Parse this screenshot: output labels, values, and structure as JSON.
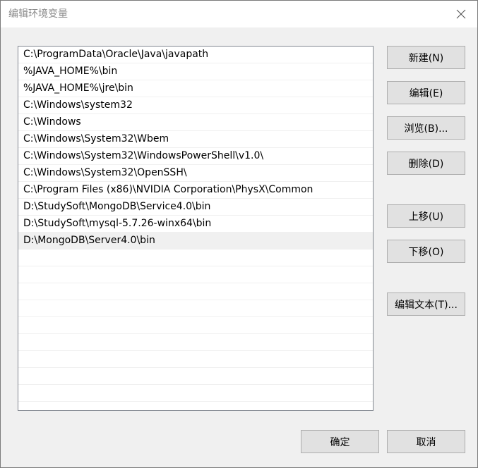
{
  "window": {
    "title": "编辑环境变量"
  },
  "path_list": {
    "items": [
      "C:\\ProgramData\\Oracle\\Java\\javapath",
      "%JAVA_HOME%\\bin",
      "%JAVA_HOME%\\jre\\bin",
      "C:\\Windows\\system32",
      "C:\\Windows",
      "C:\\Windows\\System32\\Wbem",
      "C:\\Windows\\System32\\WindowsPowerShell\\v1.0\\",
      "C:\\Windows\\System32\\OpenSSH\\",
      "C:\\Program Files (x86)\\NVIDIA Corporation\\PhysX\\Common",
      "D:\\StudySoft\\MongoDB\\Service4.0\\bin",
      "D:\\StudySoft\\mysql-5.7.26-winx64\\bin",
      "D:\\MongoDB\\Server4.0\\bin"
    ],
    "selected_index": 11
  },
  "buttons": {
    "new": "新建(N)",
    "edit": "编辑(E)",
    "browse": "浏览(B)...",
    "delete": "删除(D)",
    "move_up": "上移(U)",
    "move_down": "下移(O)",
    "edit_text": "编辑文本(T)...",
    "ok": "确定",
    "cancel": "取消"
  },
  "icons": {
    "close": "close-icon"
  },
  "colors": {
    "title_text": "#8a8a8a",
    "button_face": "#e1e1e1",
    "button_border": "#adadad",
    "selected_row": "#f0f0f0"
  }
}
